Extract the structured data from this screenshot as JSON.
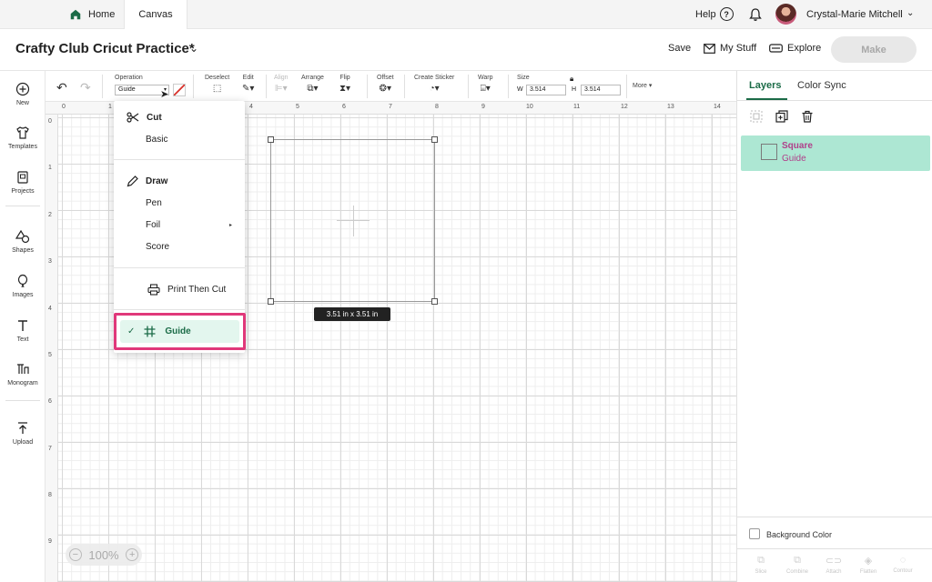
{
  "topbar": {
    "home_label": "Home",
    "canvas_label": "Canvas",
    "help_label": "Help",
    "help_glyph": "?",
    "user_name": "Crystal-Marie Mitchell",
    "chevron": "⌄"
  },
  "header": {
    "project_title": "Crafty Club Cricut Practice*",
    "save_label": "Save",
    "mystuff_label": "My Stuff",
    "explore_label": "Explore",
    "make_label": "Make"
  },
  "sidebar": {
    "items": [
      {
        "label": "New",
        "icon": "plus-circle-icon"
      },
      {
        "label": "Templates",
        "icon": "shirt-icon"
      },
      {
        "label": "Projects",
        "icon": "projects-icon"
      },
      {
        "label": "Shapes",
        "icon": "shapes-icon"
      },
      {
        "label": "Images",
        "icon": "balloon-icon"
      },
      {
        "label": "Text",
        "icon": "text-icon"
      },
      {
        "label": "Monogram",
        "icon": "monogram-icon"
      },
      {
        "label": "Upload",
        "icon": "upload-icon"
      }
    ]
  },
  "toolbar": {
    "operation_label": "Operation",
    "operation_value": "Guide",
    "deselect_label": "Deselect",
    "edit_label": "Edit",
    "align_label": "Align",
    "arrange_label": "Arrange",
    "flip_label": "Flip",
    "offset_label": "Offset",
    "create_sticker_label": "Create Sticker",
    "warp_label": "Warp",
    "size_label": "Size",
    "width_label": "W",
    "width_value": "3.514",
    "height_label": "H",
    "height_value": "3.514",
    "more_label": "More ▾"
  },
  "rulers": {
    "top": [
      "0",
      "1",
      "2",
      "3",
      "4",
      "5",
      "6",
      "7",
      "8",
      "9",
      "10",
      "11",
      "12",
      "13",
      "14"
    ],
    "left": [
      "0",
      "1",
      "2",
      "3",
      "4",
      "5",
      "6",
      "7",
      "8",
      "9"
    ]
  },
  "canvas": {
    "dimension_badge": "3.51  in x 3.51  in",
    "zoom_minus": "−",
    "zoom_value": "100%",
    "zoom_plus": "+"
  },
  "operation_menu": {
    "cut_header": "Cut",
    "basic": "Basic",
    "draw_header": "Draw",
    "pen": "Pen",
    "foil": "Foil",
    "score": "Score",
    "print_then_cut": "Print Then Cut",
    "guide": "Guide",
    "selected": "Guide",
    "check_glyph": "✓"
  },
  "right_panel": {
    "tab_layers": "Layers",
    "tab_color_sync": "Color Sync",
    "layer": {
      "name": "Square",
      "operation": "Guide"
    },
    "background_color_label": "Background Color",
    "bottom_tools": [
      "Slice",
      "Combine",
      "Attach",
      "Flatten",
      "Contour"
    ]
  },
  "colors": {
    "accent_green": "#1b6b47",
    "layer_highlight": "#ade7d3",
    "guide_highlight_border": "#e0387a",
    "layer_text": "#b0408a"
  }
}
